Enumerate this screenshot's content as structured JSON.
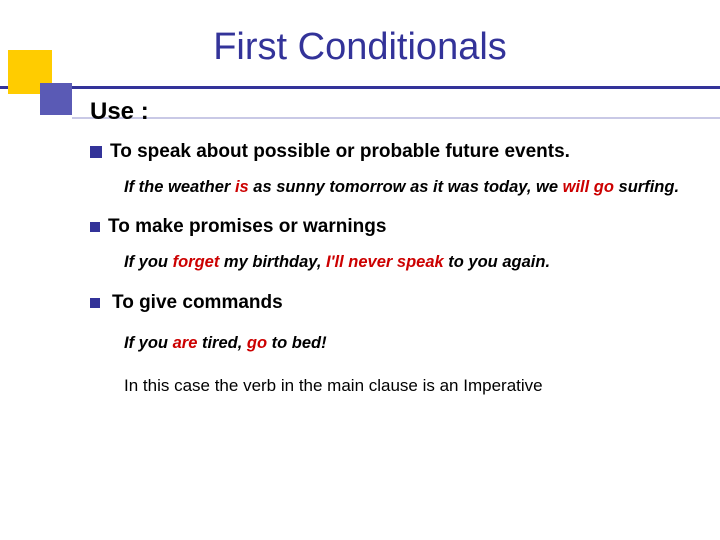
{
  "title": "First Conditionals",
  "use_label": "Use :",
  "points": [
    {
      "text_before": "To speak about possible or probable future events.",
      "example_html": "If the weather <span class='hl'>is</span> as sunny tomorrow as it was today, we <span class='hl'>will go</span> surfing."
    },
    {
      "text_before": "To make promises or warnings",
      "example_html": "If you <span class='hl'>forget</span> my birthday, <span class='hl'>I'll never speak</span> to you again."
    },
    {
      "text_before": "To give commands",
      "example_html": "If you <span class='hl'>are</span> tired, <span class='hl'>go</span> to bed!"
    }
  ],
  "note": "In this case the verb in the main clause  is an Imperative"
}
